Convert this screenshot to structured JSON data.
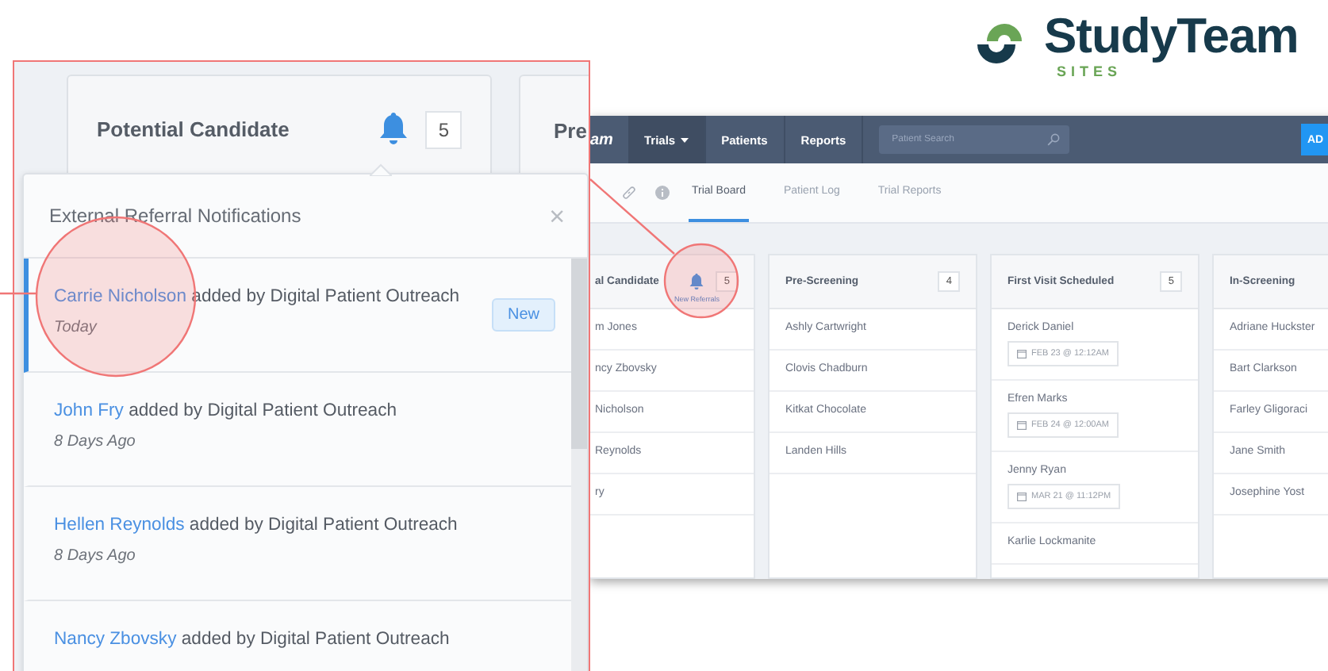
{
  "logo": {
    "name": "StudyTeam",
    "subtitle": "SITES"
  },
  "app": {
    "brand": "am",
    "nav": [
      {
        "label": "Trials",
        "selected": true,
        "dropdown": true
      },
      {
        "label": "Patients",
        "selected": false,
        "dropdown": false
      },
      {
        "label": "Reports",
        "selected": false,
        "dropdown": false
      }
    ],
    "search": {
      "placeholder": "Patient Search"
    },
    "action": "AD",
    "tabs": [
      {
        "label": "Trial Board",
        "selected": true
      },
      {
        "label": "Patient Log",
        "selected": false
      },
      {
        "label": "Trial Reports",
        "selected": false
      }
    ],
    "columns": [
      {
        "title": "al Candidate",
        "count": "5",
        "bell": true,
        "tooltip": "New Referrals",
        "cards": [
          {
            "name": "m Jones"
          },
          {
            "name": "ncy Zbovsky"
          },
          {
            "name": "Nicholson"
          },
          {
            "name": "Reynolds"
          },
          {
            "name": "ry"
          }
        ]
      },
      {
        "title": "Pre-Screening",
        "count": "4",
        "bell": false,
        "cards": [
          {
            "name": "Ashly Cartwright"
          },
          {
            "name": "Clovis Chadburn"
          },
          {
            "name": "Kitkat Chocolate"
          },
          {
            "name": "Landen Hills"
          }
        ]
      },
      {
        "title": "First Visit Scheduled",
        "count": "5",
        "bell": false,
        "cards": [
          {
            "name": "Derick Daniel",
            "date": "FEB 23 @ 12:12AM"
          },
          {
            "name": "Efren Marks",
            "date": "FEB 24 @ 12:00AM"
          },
          {
            "name": "Jenny Ryan",
            "date": "MAR 21 @ 11:12PM"
          },
          {
            "name": "Karlie Lockmanite"
          }
        ]
      },
      {
        "title": "In-Screening",
        "cards": [
          {
            "name": "Adriane Huckster"
          },
          {
            "name": "Bart Clarkson"
          },
          {
            "name": "Farley Gligoraci"
          },
          {
            "name": "Jane Smith"
          },
          {
            "name": "Josephine Yost"
          }
        ]
      }
    ]
  },
  "callout": {
    "card": {
      "title": "Potential Candidate",
      "count": "5"
    },
    "next_card": {
      "title": "Pre"
    },
    "popup": {
      "title": "External Referral Notifications",
      "close": "×",
      "items": [
        {
          "name": "Carrie Nicholson",
          "text": "added by Digital Patient Outreach",
          "time": "Today",
          "unread": true,
          "badge": "New"
        },
        {
          "name": "John Fry",
          "text": "added by Digital Patient Outreach",
          "time": "8 Days Ago",
          "unread": false
        },
        {
          "name": "Hellen Reynolds",
          "text": "added by Digital Patient Outreach",
          "time": "8 Days Ago",
          "unread": false
        },
        {
          "name": "Nancy Zbovsky",
          "text": "added by Digital Patient Outreach",
          "unread": false
        }
      ]
    }
  }
}
